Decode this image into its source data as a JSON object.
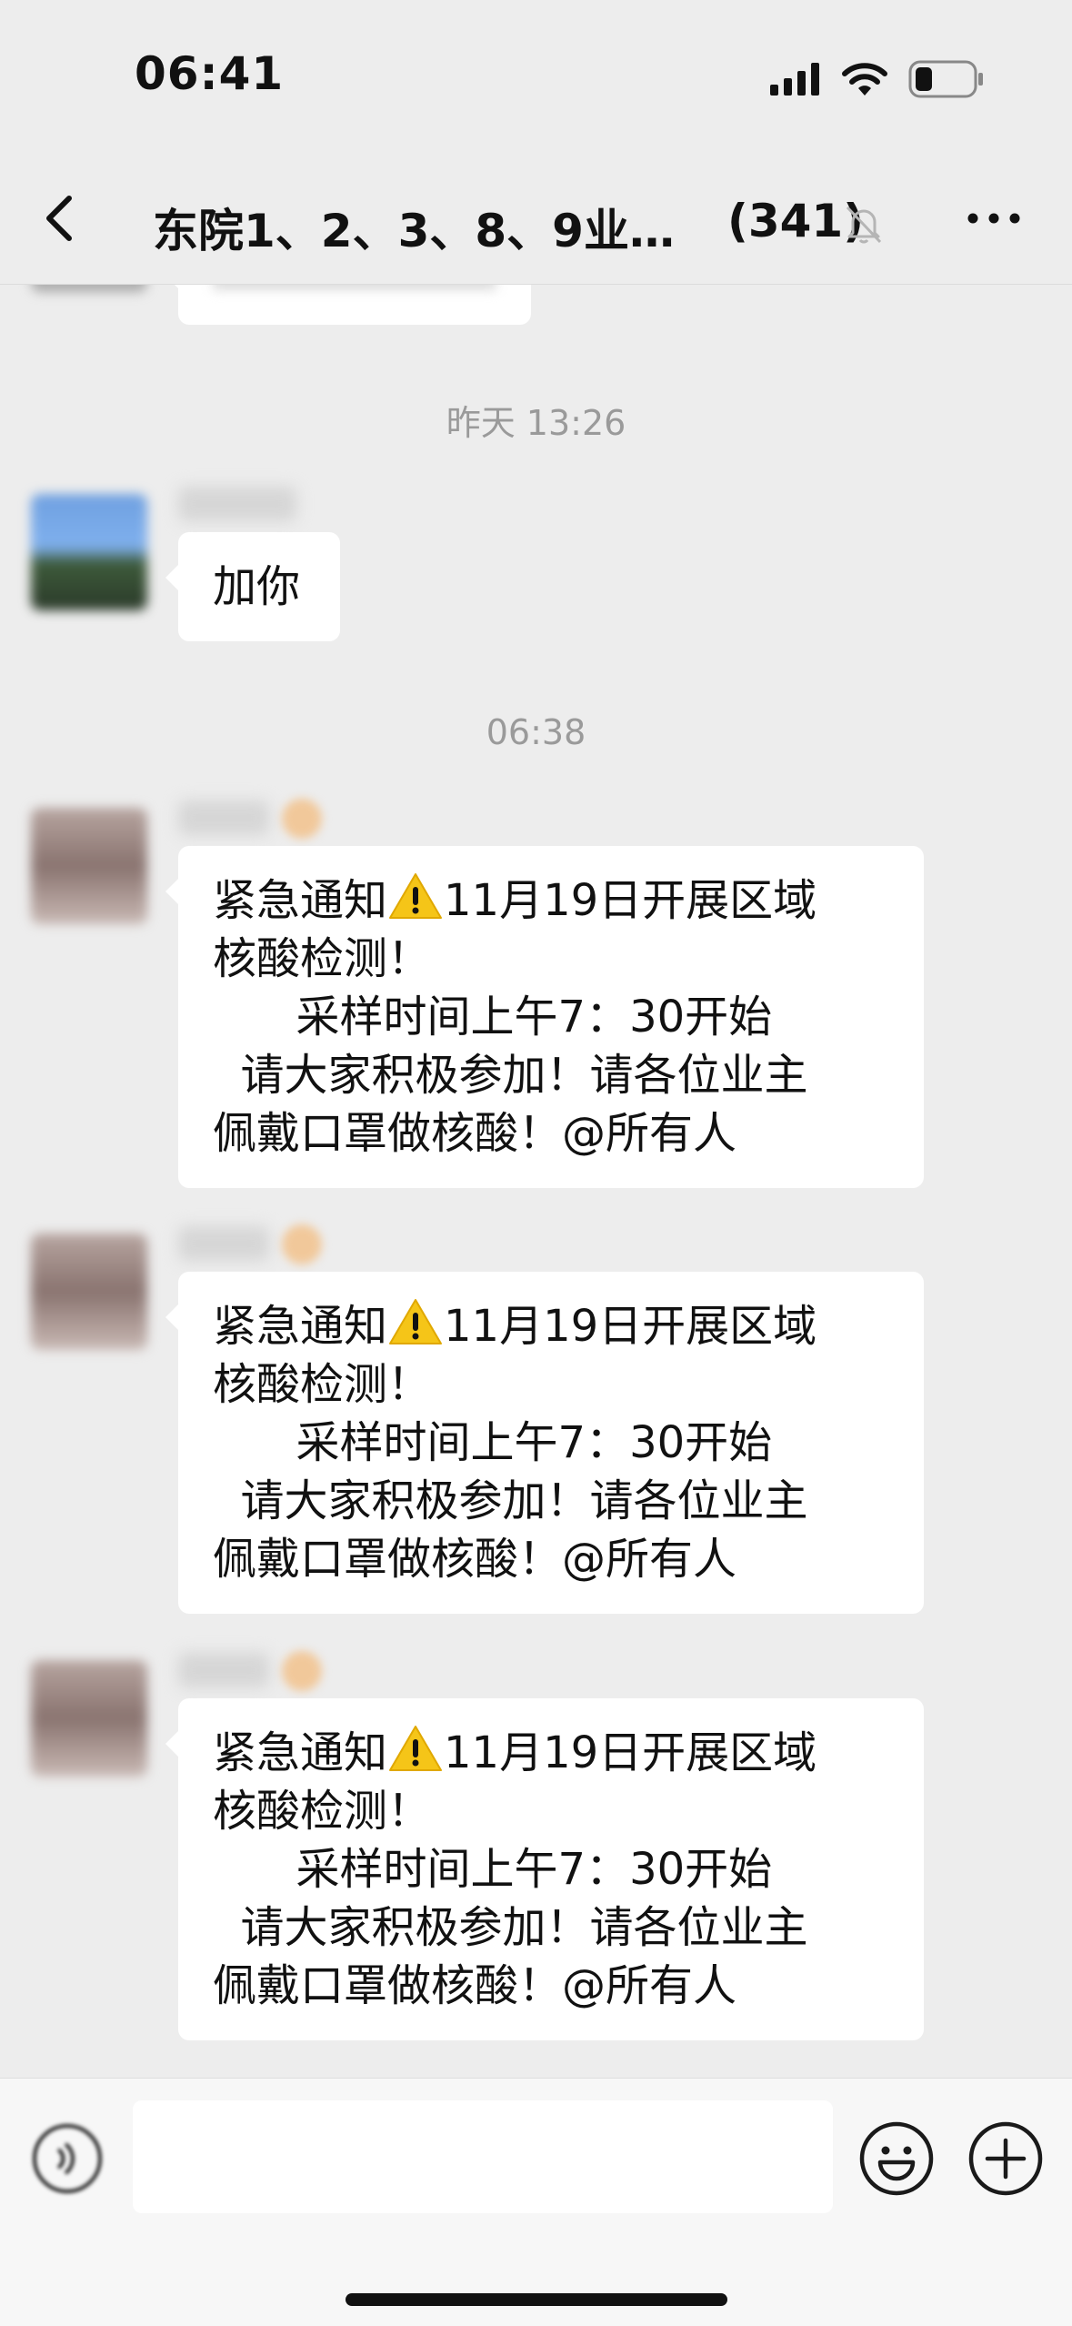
{
  "status_bar": {
    "time": "06:41"
  },
  "nav": {
    "title": "东院1、2、3、8、9业…",
    "member_count": "(341)"
  },
  "chat": {
    "timestamp_1": "昨天 13:26",
    "message_1": "加你",
    "timestamp_2": "06:38",
    "notices": [
      {
        "line1_a": "紧急通知",
        "line1_b": "11月19日开展区域",
        "line2": "核酸检测！",
        "line3": "      采样时间上午7：30开始",
        "line4": "  请大家积极参加！请各位业主",
        "line5": "佩戴口罩做核酸！@所有人"
      },
      {
        "line1_a": "紧急通知",
        "line1_b": "11月19日开展区域",
        "line2": "核酸检测！",
        "line3": "      采样时间上午7：30开始",
        "line4": "  请大家积极参加！请各位业主",
        "line5": "佩戴口罩做核酸！@所有人"
      },
      {
        "line1_a": "紧急通知",
        "line1_b": "11月19日开展区域",
        "line2": "核酸检测！",
        "line3": "      采样时间上午7：30开始",
        "line4": "  请大家积极参加！请各位业主",
        "line5": "佩戴口罩做核酸！@所有人"
      }
    ]
  },
  "icons": {
    "back": "chevron-left-icon",
    "mute": "bell-off-icon",
    "more": "more-dots-icon",
    "voice": "voice-icon",
    "emoji": "emoji-icon",
    "plus": "plus-icon",
    "warning": "warning-icon"
  },
  "colors": {
    "background": "#ededed",
    "bubble": "#ffffff",
    "warning": "#f5c518"
  }
}
